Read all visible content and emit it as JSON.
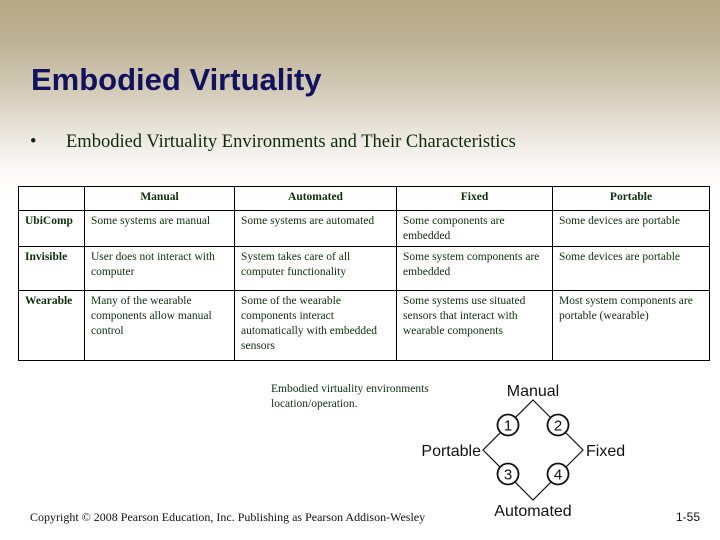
{
  "slide": {
    "title": "Embodied Virtuality",
    "bullet_symbol": "•",
    "bullet_text": "Embodied Virtuality Environments and Their Characteristics"
  },
  "table": {
    "headers": [
      "",
      "Manual",
      "Automated",
      "Fixed",
      "Portable"
    ],
    "rows": [
      {
        "label": "UbiComp",
        "cells": [
          "Some systems are manual",
          "Some systems are automated",
          "Some components are embedded",
          "Some devices are portable"
        ]
      },
      {
        "label": "Invisible",
        "cells": [
          "User does not interact with computer",
          "System takes care of all computer functionality",
          "Some system components are embedded",
          "Some devices are portable"
        ]
      },
      {
        "label": "Wearable",
        "cells": [
          "Many of the wearable components allow manual control",
          "Some of the wearable components interact automatically with embedded sensors",
          "Some systems use situated sensors that interact with wearable components",
          "Most system components are portable (wearable)"
        ]
      }
    ]
  },
  "figure": {
    "caption_line1": "Embodied virtuality environments",
    "caption_line2": "location/operation.",
    "labels": {
      "top": "Manual",
      "left": "Portable",
      "right": "Fixed",
      "bottom": "Automated"
    },
    "nodes": [
      "1",
      "2",
      "3",
      "4"
    ]
  },
  "footer": {
    "copyright": "Copyright © 2008 Pearson Education, Inc. Publishing as Pearson Addison-Wesley",
    "page_number": "1-55"
  }
}
